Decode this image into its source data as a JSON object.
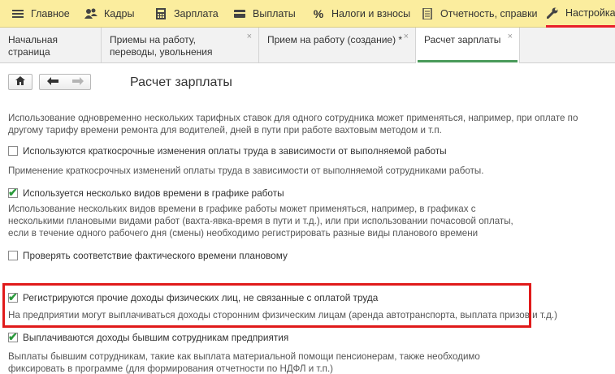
{
  "menu": {
    "items": [
      {
        "label": "Главное",
        "icon": "hamburger-icon"
      },
      {
        "label": "Кадры",
        "icon": "people-icon"
      },
      {
        "label": "Зарплата",
        "icon": "calculator-icon"
      },
      {
        "label": "Выплаты",
        "icon": "wallet-icon"
      },
      {
        "label": "Налоги и взносы",
        "icon": "percent-icon"
      },
      {
        "label": "Отчетность, справки",
        "icon": "document-icon"
      },
      {
        "label": "Настройка",
        "icon": "wrench-icon"
      }
    ]
  },
  "tabs": [
    {
      "label": "Начальная страница"
    },
    {
      "label": "Приемы на работу, переводы, увольнения",
      "close": "×"
    },
    {
      "label": "Прием на работу (создание) *",
      "close": "×"
    },
    {
      "label": "Расчет зарплаты",
      "close": "×"
    }
  ],
  "toolbar": {
    "home": "home-icon",
    "back": "arrow-left-icon",
    "forward": "arrow-right-icon"
  },
  "page": {
    "title": "Расчет зарплаты"
  },
  "settings": {
    "desc0": "Использование одновременно нескольких тарифных ставок для одного сотрудника может применяться, например, при оплате по другому тарифу времени ремонта для водителей, дней в пути при работе вахтовым методом и т.п.",
    "opt1": {
      "label": "Используются краткосрочные изменения оплаты труда в зависимости от выполняемой работы",
      "checked": false
    },
    "desc1": "Применение краткосрочных изменений оплаты труда в зависимости от выполняемой сотрудниками работы.",
    "opt2": {
      "label": "Используется несколько видов времени в графике работы",
      "checked": true
    },
    "desc2": "Использование нескольких видов времени в графике работы может применяться, например, в графиках с несколькими плановыми видами работ (вахта-явка-время в пути и т.д.), или при использовании почасовой оплаты, если в течение одного рабочего дня (смены) необходимо регистрировать разные виды планового времени",
    "opt3": {
      "label": "Проверять соответствие фактического времени плановому",
      "checked": false
    },
    "opt4": {
      "label": "Регистрируются прочие доходы физических лиц, не связанные с оплатой труда",
      "checked": true
    },
    "desc4": "На предприятии могут выплачиваться доходы сторонним физическим лицам (аренда автотранспорта, выплата призов и т.д.)",
    "opt5": {
      "label": "Выплачиваются доходы бывшим сотрудникам предприятия",
      "checked": true
    },
    "desc5": "Выплаты бывшим сотрудникам, такие как выплата материальной помощи пенсионерам, также необходимо фиксировать в программе (для формирования отчетности по НДФЛ и т.п.)",
    "checkmark": "✔"
  }
}
